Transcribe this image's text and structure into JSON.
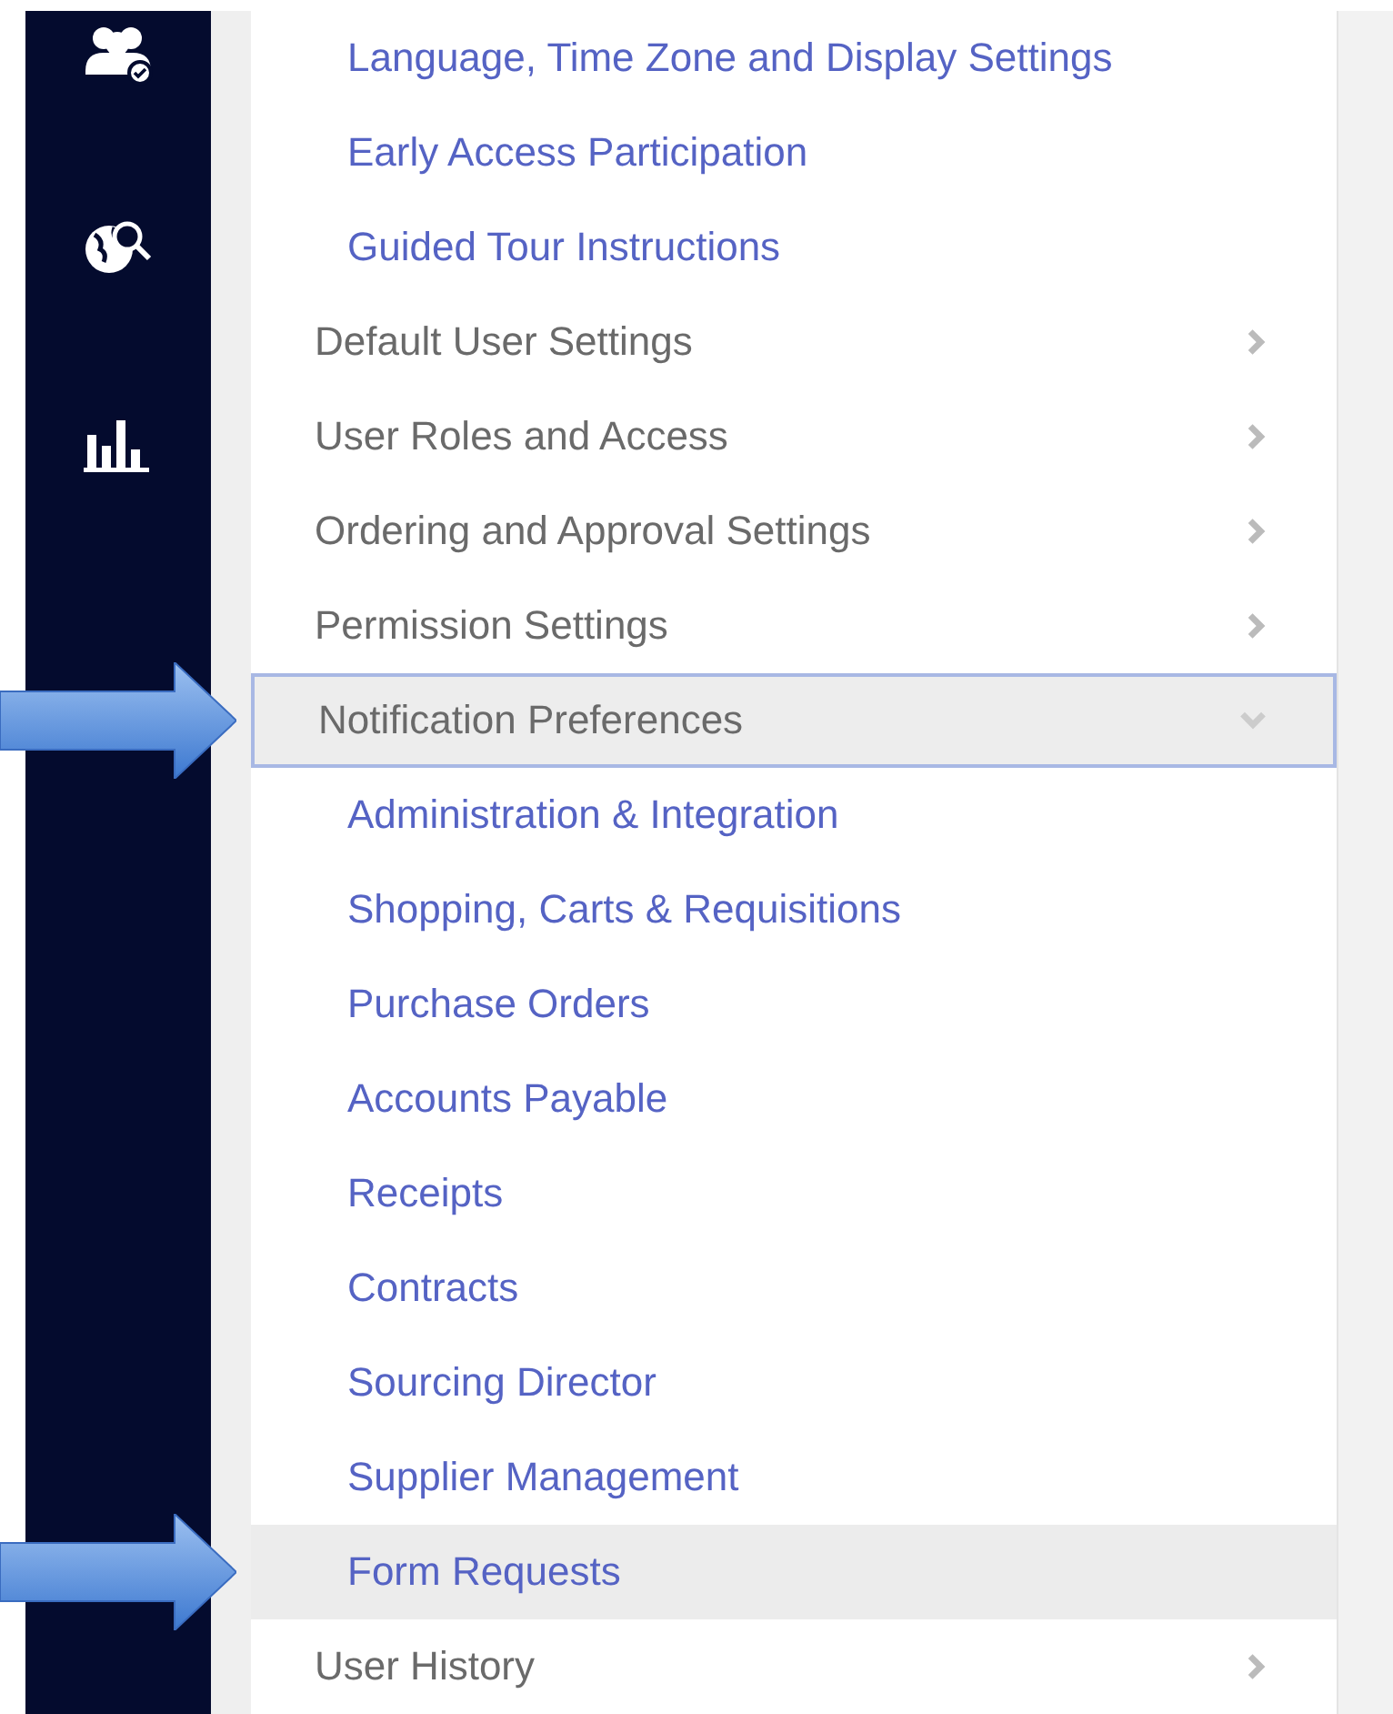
{
  "menu": [
    {
      "kind": "link",
      "label": "Language, Time Zone and Display Settings",
      "selected": false
    },
    {
      "kind": "link",
      "label": "Early Access Participation",
      "selected": false
    },
    {
      "kind": "link",
      "label": "Guided Tour Instructions",
      "selected": false
    },
    {
      "kind": "section",
      "label": "Default User Settings",
      "expanded": false,
      "selected": false
    },
    {
      "kind": "section",
      "label": "User Roles and Access",
      "expanded": false,
      "selected": false
    },
    {
      "kind": "section",
      "label": "Ordering and Approval Settings",
      "expanded": false,
      "selected": false
    },
    {
      "kind": "section",
      "label": "Permission Settings",
      "expanded": false,
      "selected": false
    },
    {
      "kind": "section",
      "label": "Notification Preferences",
      "expanded": true,
      "selected": true,
      "children": [
        {
          "label": "Administration & Integration",
          "selected": false
        },
        {
          "label": "Shopping, Carts & Requisitions",
          "selected": false
        },
        {
          "label": "Purchase Orders",
          "selected": false
        },
        {
          "label": "Accounts Payable",
          "selected": false
        },
        {
          "label": "Receipts",
          "selected": false
        },
        {
          "label": "Contracts",
          "selected": false
        },
        {
          "label": "Sourcing Director",
          "selected": false
        },
        {
          "label": "Supplier Management",
          "selected": false
        },
        {
          "label": "Form Requests",
          "selected": true
        }
      ]
    },
    {
      "kind": "section",
      "label": "User History",
      "expanded": false,
      "selected": false
    }
  ]
}
